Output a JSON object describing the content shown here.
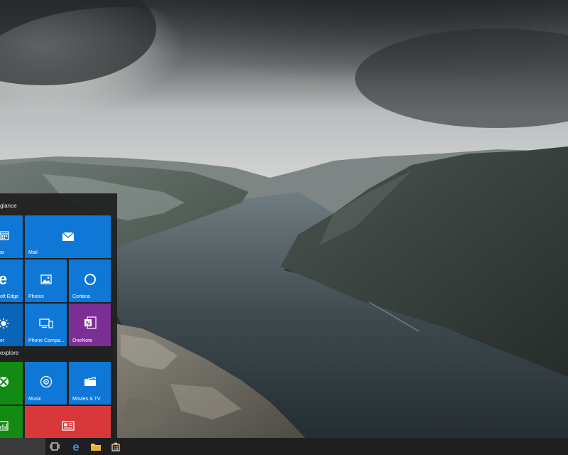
{
  "colors": {
    "tile_blue": "#0f78d7",
    "tile_green": "#128a14",
    "tile_purple": "#7b2f95",
    "tile_red": "#d9383b",
    "tile_dark_blue": "#0a64b8",
    "menu_bg": "#202020",
    "taskbar_bg": "#1f1f1f"
  },
  "start_menu": {
    "groups": [
      {
        "header": "glance"
      },
      {
        "header": "explore"
      }
    ],
    "tiles": {
      "calendar": {
        "label": "ar",
        "icon": "calendar-icon"
      },
      "mail": {
        "label": "Mail",
        "icon": "mail-icon"
      },
      "edge": {
        "label": "oft Edge",
        "icon": "edge-icon"
      },
      "photos": {
        "label": "Photos",
        "icon": "photos-icon"
      },
      "cortana": {
        "label": "Cortana",
        "icon": "cortana-icon"
      },
      "weather": {
        "label": "er",
        "icon": "weather-icon"
      },
      "phone": {
        "label": "Phone Compa...",
        "icon": "phone-companion-icon"
      },
      "onenote": {
        "label": "OneNote",
        "icon": "onenote-icon"
      },
      "xbox": {
        "label": "",
        "icon": "xbox-icon"
      },
      "music": {
        "label": "Music",
        "icon": "music-icon"
      },
      "movies": {
        "label": "Movies & TV",
        "icon": "movies-tv-icon"
      },
      "money": {
        "label": "",
        "icon": "money-icon"
      },
      "news": {
        "label": "",
        "icon": "news-icon"
      }
    }
  },
  "taskbar": {
    "icons": [
      "task-view-icon",
      "edge-icon",
      "file-explorer-icon",
      "store-icon"
    ]
  }
}
